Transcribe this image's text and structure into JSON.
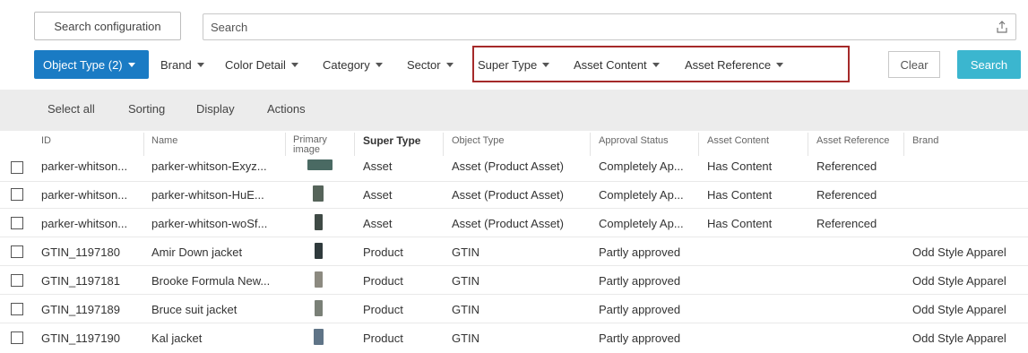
{
  "search": {
    "config_button": "Search configuration",
    "placeholder": "Search"
  },
  "filters": {
    "object_type": "Object Type (2)",
    "brand": "Brand",
    "color_detail": "Color Detail",
    "category": "Category",
    "sector": "Sector",
    "super_type": "Super Type",
    "asset_content": "Asset Content",
    "asset_reference": "Asset Reference",
    "clear": "Clear",
    "search": "Search"
  },
  "toolbar": {
    "select_all": "Select all",
    "sorting": "Sorting",
    "display": "Display",
    "actions": "Actions"
  },
  "columns": {
    "id": "ID",
    "name": "Name",
    "primary_image_1": "Primary",
    "primary_image_2": "image",
    "super_type": "Super Type",
    "object_type": "Object Type",
    "approval_status": "Approval Status",
    "asset_content": "Asset Content",
    "asset_reference": "Asset Reference",
    "brand": "Brand"
  },
  "rows": [
    {
      "id": "parker-whitson...",
      "name": "parker-whitson-Exyz...",
      "super_type": "Asset",
      "object_type": "Asset (Product Asset)",
      "approval": "Completely Ap...",
      "asset_content": "Has Content",
      "asset_reference": "Referenced",
      "brand": "",
      "thumb_color": "#4a6a63"
    },
    {
      "id": "parker-whitson...",
      "name": "parker-whitson-HuE...",
      "super_type": "Asset",
      "object_type": "Asset (Product Asset)",
      "approval": "Completely Ap...",
      "asset_content": "Has Content",
      "asset_reference": "Referenced",
      "brand": "",
      "thumb_color": "#56645a"
    },
    {
      "id": "parker-whitson...",
      "name": "parker-whitson-woSf...",
      "super_type": "Asset",
      "object_type": "Asset (Product Asset)",
      "approval": "Completely Ap...",
      "asset_content": "Has Content",
      "asset_reference": "Referenced",
      "brand": "",
      "thumb_color": "#3f4a45"
    },
    {
      "id": "GTIN_1197180",
      "name": "Amir Down jacket",
      "super_type": "Product",
      "object_type": "GTIN",
      "approval": "Partly approved",
      "asset_content": "",
      "asset_reference": "",
      "brand": "Odd Style Apparel",
      "thumb_color": "#2f3a3c"
    },
    {
      "id": "GTIN_1197181",
      "name": "Brooke Formula New...",
      "super_type": "Product",
      "object_type": "GTIN",
      "approval": "Partly approved",
      "asset_content": "",
      "asset_reference": "",
      "brand": "Odd Style Apparel",
      "thumb_color": "#8c8a80"
    },
    {
      "id": "GTIN_1197189",
      "name": "Bruce suit jacket",
      "super_type": "Product",
      "object_type": "GTIN",
      "approval": "Partly approved",
      "asset_content": "",
      "asset_reference": "",
      "brand": "Odd Style Apparel",
      "thumb_color": "#7a8077"
    },
    {
      "id": "GTIN_1197190",
      "name": "Kal jacket",
      "super_type": "Product",
      "object_type": "GTIN",
      "approval": "Partly approved",
      "asset_content": "",
      "asset_reference": "",
      "brand": "Odd Style Apparel",
      "thumb_color": "#5f7487"
    }
  ],
  "colors": {
    "primary_blue": "#1a7bc4",
    "search_teal": "#3bb6cf",
    "highlight_red": "#a52a2a",
    "toolbar_gray": "#ececec"
  }
}
